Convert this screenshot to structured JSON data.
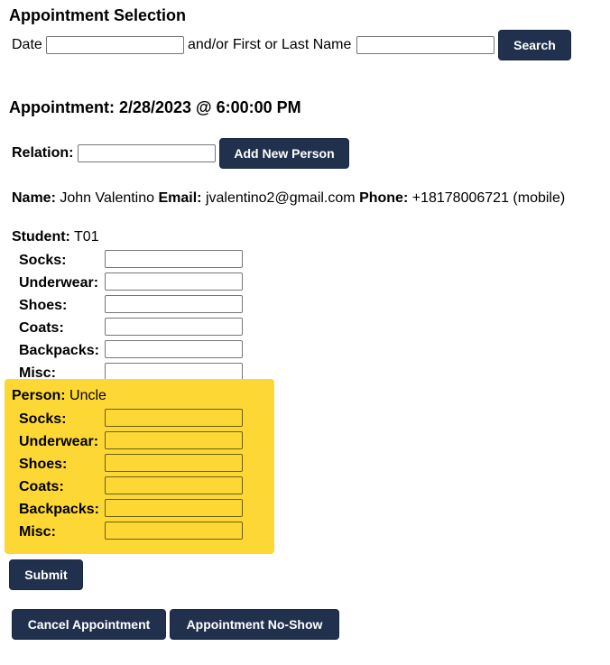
{
  "header": {
    "title": "Appointment Selection",
    "date_label": "Date",
    "name_label": "and/or First or Last Name",
    "date_value": "",
    "name_value": "",
    "search_label": "Search"
  },
  "appointment": {
    "title": "Appointment: 2/28/2023 @ 6:00:00 PM"
  },
  "relation": {
    "label": "Relation:",
    "value": "",
    "add_label": "Add New Person"
  },
  "contact": {
    "name_label": "Name:",
    "name_value": "John Valentino",
    "email_label": "Email:",
    "email_value": "jvalentino2@gmail.com",
    "phone_label": "Phone:",
    "phone_value": "+18178006721 (mobile)"
  },
  "student": {
    "label": "Student:",
    "value": "T01",
    "items": [
      {
        "label": "Socks:",
        "value": ""
      },
      {
        "label": "Underwear:",
        "value": ""
      },
      {
        "label": "Shoes:",
        "value": ""
      },
      {
        "label": "Coats:",
        "value": ""
      },
      {
        "label": "Backpacks:",
        "value": ""
      },
      {
        "label": "Misc:",
        "value": ""
      }
    ]
  },
  "person": {
    "label": "Person:",
    "value": "Uncle",
    "items": [
      {
        "label": "Socks:",
        "value": ""
      },
      {
        "label": "Underwear:",
        "value": ""
      },
      {
        "label": "Shoes:",
        "value": ""
      },
      {
        "label": "Coats:",
        "value": ""
      },
      {
        "label": "Backpacks:",
        "value": ""
      },
      {
        "label": "Misc:",
        "value": ""
      }
    ],
    "highlight_color": "#fdd835"
  },
  "actions": {
    "submit_label": "Submit",
    "cancel_label": "Cancel Appointment",
    "noshow_label": "Appointment No-Show"
  },
  "colors": {
    "button_bg": "#21314d",
    "button_text": "#ffffff"
  }
}
